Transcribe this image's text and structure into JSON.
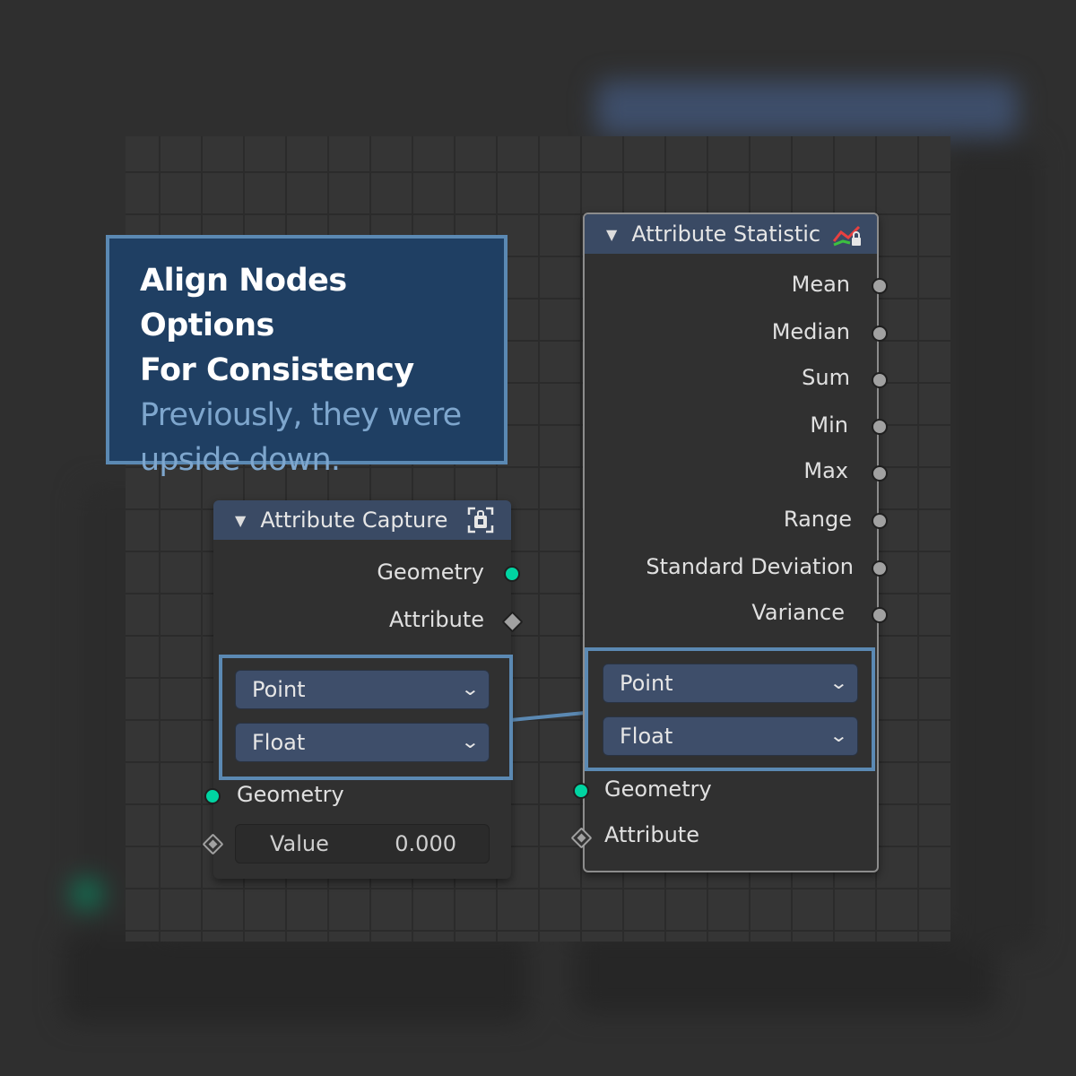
{
  "info": {
    "title_line1": "Align Nodes Options",
    "title_line2": "For Consistency",
    "sub_line1": "Previously, they were",
    "sub_line2": "upside down."
  },
  "capture_node": {
    "title": "Attribute Capture",
    "out_geometry": "Geometry",
    "out_attribute": "Attribute",
    "domain": "Point",
    "data_type": "Float",
    "in_geometry": "Geometry",
    "value_label": "Value",
    "value": "0.000"
  },
  "statistic_node": {
    "title": "Attribute Statistic",
    "outputs": [
      "Mean",
      "Median",
      "Sum",
      "Min",
      "Max",
      "Range",
      "Standard Deviation",
      "Variance"
    ],
    "domain": "Point",
    "data_type": "Float",
    "in_geometry": "Geometry",
    "in_attribute": "Attribute"
  },
  "colors": {
    "highlight": "#5b89b3",
    "info_bg": "#1f3f63",
    "geometry_socket": "#00d4a2",
    "node_header": "#3a4a64"
  },
  "icons": {
    "collapse": "triangle-down-icon",
    "capture": "capture-icon",
    "statistic": "statistic-icon",
    "dropdown": "chevron-down-icon"
  }
}
